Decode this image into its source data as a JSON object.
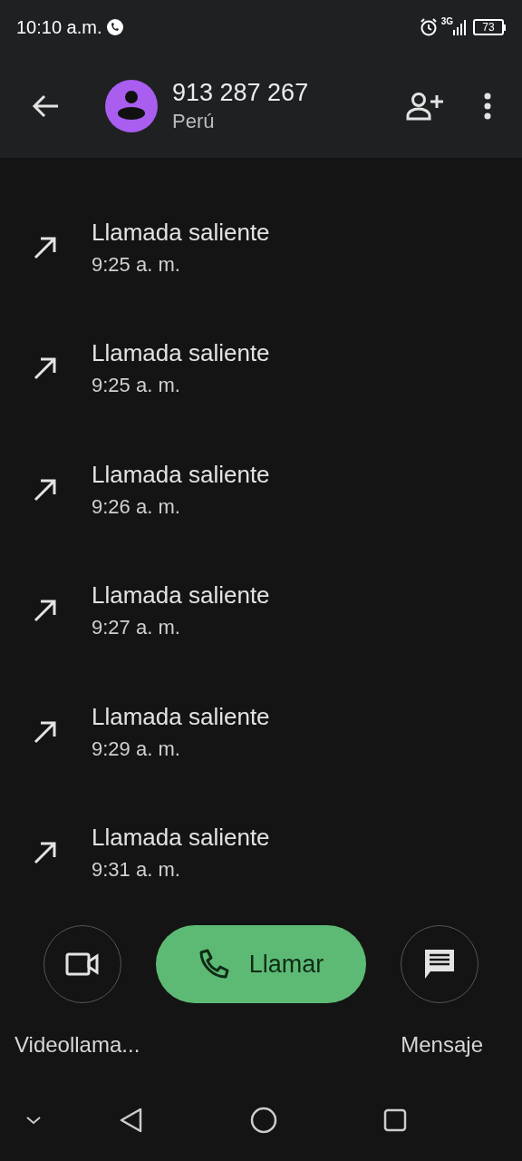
{
  "status_bar": {
    "time": "10:10 a.m.",
    "network": "3G",
    "battery": "73"
  },
  "header": {
    "number": "913 287 267",
    "country": "Perú"
  },
  "calls": [
    {
      "kind": "outgoing",
      "label": "Llamada saliente",
      "time": "9:25 a. m."
    },
    {
      "kind": "outgoing",
      "label": "Llamada saliente",
      "time": "9:25 a. m."
    },
    {
      "kind": "outgoing",
      "label": "Llamada saliente",
      "time": "9:26 a. m."
    },
    {
      "kind": "outgoing",
      "label": "Llamada saliente",
      "time": "9:27 a. m."
    },
    {
      "kind": "outgoing",
      "label": "Llamada saliente",
      "time": "9:29 a. m."
    },
    {
      "kind": "outgoing",
      "label": "Llamada saliente",
      "time": "9:31 a. m."
    }
  ],
  "actions": {
    "video_label": "Videollama...",
    "call_label": "Llamar",
    "message_label": "Mensaje"
  }
}
